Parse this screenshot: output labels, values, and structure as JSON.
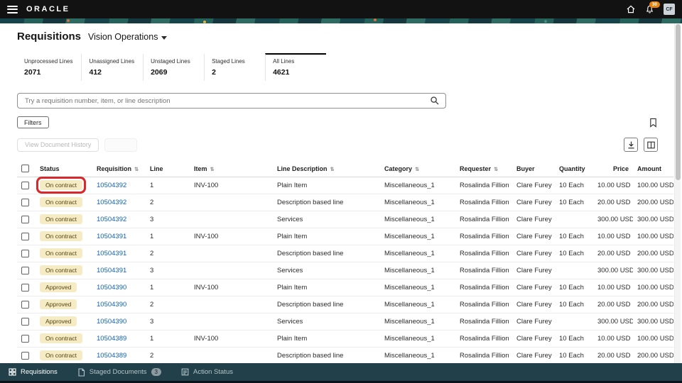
{
  "colors": {
    "link": "#0f62ac",
    "status_badge_bg": "#f5ebc4",
    "status_badge_text": "#564712",
    "highlight_box": "#d8282b",
    "notification_badge": "#e8830f",
    "footer_bg": "#21404a"
  },
  "icons": {
    "sort": "⇅"
  },
  "header": {
    "brand": "ORACLE",
    "notification_count": "30",
    "avatar_initials": "CF"
  },
  "page": {
    "title": "Requisitions",
    "context": "Vision Operations"
  },
  "summary_tabs": [
    {
      "label": "Unprocessed Lines",
      "value": "2071",
      "active": false
    },
    {
      "label": "Unassigned Lines",
      "value": "412",
      "active": false
    },
    {
      "label": "Unstaged Lines",
      "value": "2069",
      "active": false
    },
    {
      "label": "Staged Lines",
      "value": "2",
      "active": false
    },
    {
      "label": "All Lines",
      "value": "4621",
      "active": true
    }
  ],
  "search": {
    "placeholder": "Try a requisition number, item, or line description"
  },
  "toolbar": {
    "filters": "Filters",
    "view_document_history": "View Document History"
  },
  "table": {
    "columns": [
      {
        "label": "Status",
        "key": "status",
        "sortable": false
      },
      {
        "label": "Requisition",
        "key": "requisition",
        "sortable": true
      },
      {
        "label": "Line",
        "key": "line",
        "sortable": false
      },
      {
        "label": "Item",
        "key": "item",
        "sortable": true
      },
      {
        "label": "Line Description",
        "key": "line_description",
        "sortable": true
      },
      {
        "label": "Category",
        "key": "category",
        "sortable": true
      },
      {
        "label": "Requester",
        "key": "requester",
        "sortable": true
      },
      {
        "label": "Buyer",
        "key": "buyer",
        "sortable": false
      },
      {
        "label": "Quantity",
        "key": "quantity",
        "sortable": false
      },
      {
        "label": "Price",
        "key": "price",
        "sortable": false
      },
      {
        "label": "Amount",
        "key": "amount",
        "sortable": false
      }
    ],
    "rows": [
      {
        "status": "On contract",
        "requisition": "10504392",
        "line": "1",
        "item": "INV-100",
        "line_description": "Plain Item",
        "category": "Miscellaneous_1",
        "requester": "Rosalinda Fillion",
        "buyer": "Clare Furey",
        "quantity": "10 Each",
        "price": "10.00 USD",
        "amount": "100.00 USD",
        "highlighted": true
      },
      {
        "status": "On contract",
        "requisition": "10504392",
        "line": "2",
        "item": "",
        "line_description": "Description based line",
        "category": "Miscellaneous_1",
        "requester": "Rosalinda Fillion",
        "buyer": "Clare Furey",
        "quantity": "10 Each",
        "price": "20.00 USD",
        "amount": "200.00 USD",
        "highlighted": false
      },
      {
        "status": "On contract",
        "requisition": "10504392",
        "line": "3",
        "item": "",
        "line_description": "Services",
        "category": "Miscellaneous_1",
        "requester": "Rosalinda Fillion",
        "buyer": "Clare Furey",
        "quantity": "",
        "price": "300.00 USD",
        "amount": "300.00 USD",
        "highlighted": false
      },
      {
        "status": "On contract",
        "requisition": "10504391",
        "line": "1",
        "item": "INV-100",
        "line_description": "Plain Item",
        "category": "Miscellaneous_1",
        "requester": "Rosalinda Fillion",
        "buyer": "Clare Furey",
        "quantity": "10 Each",
        "price": "10.00 USD",
        "amount": "100.00 USD",
        "highlighted": false
      },
      {
        "status": "On contract",
        "requisition": "10504391",
        "line": "2",
        "item": "",
        "line_description": "Description based line",
        "category": "Miscellaneous_1",
        "requester": "Rosalinda Fillion",
        "buyer": "Clare Furey",
        "quantity": "10 Each",
        "price": "20.00 USD",
        "amount": "200.00 USD",
        "highlighted": false
      },
      {
        "status": "On contract",
        "requisition": "10504391",
        "line": "3",
        "item": "",
        "line_description": "Services",
        "category": "Miscellaneous_1",
        "requester": "Rosalinda Fillion",
        "buyer": "Clare Furey",
        "quantity": "",
        "price": "300.00 USD",
        "amount": "300.00 USD",
        "highlighted": false
      },
      {
        "status": "Approved",
        "requisition": "10504390",
        "line": "1",
        "item": "INV-100",
        "line_description": "Plain Item",
        "category": "Miscellaneous_1",
        "requester": "Rosalinda Fillion",
        "buyer": "Clare Furey",
        "quantity": "10 Each",
        "price": "10.00 USD",
        "amount": "100.00 USD",
        "highlighted": false
      },
      {
        "status": "Approved",
        "requisition": "10504390",
        "line": "2",
        "item": "",
        "line_description": "Description based line",
        "category": "Miscellaneous_1",
        "requester": "Rosalinda Fillion",
        "buyer": "Clare Furey",
        "quantity": "10 Each",
        "price": "20.00 USD",
        "amount": "200.00 USD",
        "highlighted": false
      },
      {
        "status": "Approved",
        "requisition": "10504390",
        "line": "3",
        "item": "",
        "line_description": "Services",
        "category": "Miscellaneous_1",
        "requester": "Rosalinda Fillion",
        "buyer": "Clare Furey",
        "quantity": "",
        "price": "300.00 USD",
        "amount": "300.00 USD",
        "highlighted": false
      },
      {
        "status": "On contract",
        "requisition": "10504389",
        "line": "1",
        "item": "INV-100",
        "line_description": "Plain Item",
        "category": "Miscellaneous_1",
        "requester": "Rosalinda Fillion",
        "buyer": "Clare Furey",
        "quantity": "10 Each",
        "price": "10.00 USD",
        "amount": "100.00 USD",
        "highlighted": false
      },
      {
        "status": "On contract",
        "requisition": "10504389",
        "line": "2",
        "item": "",
        "line_description": "Description based line",
        "category": "Miscellaneous_1",
        "requester": "Rosalinda Fillion",
        "buyer": "Clare Furey",
        "quantity": "10 Each",
        "price": "20.00 USD",
        "amount": "200.00 USD",
        "highlighted": false
      }
    ]
  },
  "footer": {
    "items": [
      {
        "label": "Requisitions",
        "active": true
      },
      {
        "label": "Staged Documents",
        "badge": "3",
        "active": false
      },
      {
        "label": "Action Status",
        "active": false
      }
    ]
  }
}
